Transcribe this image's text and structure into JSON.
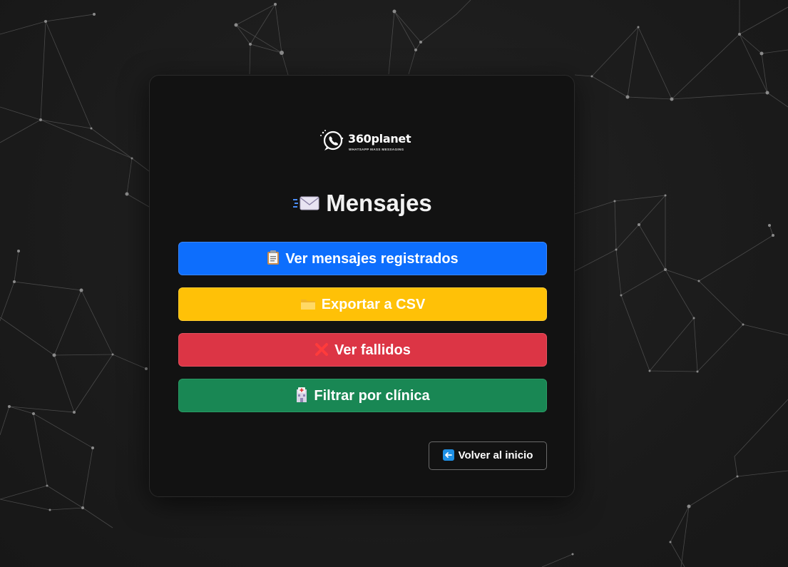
{
  "brand": {
    "name": "360planet",
    "tagline": "WHATSAPP MASS MESSAGING"
  },
  "page": {
    "title": "Mensajes",
    "title_icon": "incoming-envelope-icon"
  },
  "actions": [
    {
      "label": "Ver mensajes registrados",
      "icon": "clipboard-icon",
      "color": "#0d6efd"
    },
    {
      "label": "Exportar a CSV",
      "icon": "folder-icon",
      "color": "#ffc107"
    },
    {
      "label": "Ver fallidos",
      "icon": "cross-mark-icon",
      "color": "#dc3545"
    },
    {
      "label": "Filtrar por clínica",
      "icon": "hospital-icon",
      "color": "#198754"
    }
  ],
  "back": {
    "label": "Volver al inicio",
    "icon": "left-arrow-icon"
  }
}
